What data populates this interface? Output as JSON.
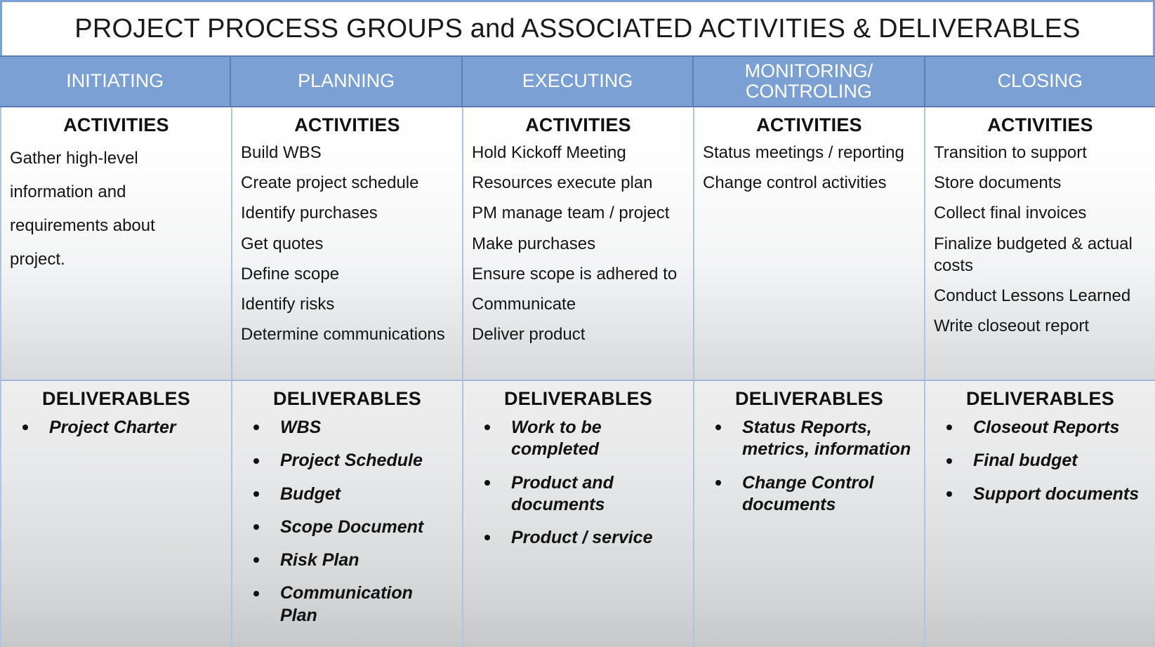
{
  "title": "PROJECT PROCESS GROUPS and ASSOCIATED ACTIVITIES & DELIVERABLES",
  "theme": {
    "header_blue": "#7BA0D4",
    "header_blue_border": "#5B7FB3",
    "divider_blue": "#AEC4E3",
    "text_dark": "#111111",
    "header_text": "#FFFFFF"
  },
  "labels": {
    "activities": "ACTIVITIES",
    "deliverables": "DELIVERABLES"
  },
  "columns": [
    {
      "phase": "INITIATING",
      "activities_heading": "ACTIVITIES",
      "activities": [
        "Gather high-level",
        "information and",
        "requirements about",
        "project."
      ],
      "activities_style": "paragraph",
      "deliverables_heading": "DELIVERABLES",
      "deliverables": [
        "Project Charter"
      ]
    },
    {
      "phase": "PLANNING",
      "activities_heading": "ACTIVITIES",
      "activities": [
        "Build WBS",
        "Create project schedule",
        "Identify purchases",
        "Get quotes",
        "Define scope",
        "Identify risks",
        "Determine communications"
      ],
      "activities_style": "list",
      "deliverables_heading": "DELIVERABLES",
      "deliverables": [
        "WBS",
        "Project Schedule",
        "Budget",
        "Scope Document",
        "Risk Plan",
        "Communication Plan"
      ]
    },
    {
      "phase": "EXECUTING",
      "activities_heading": "ACTIVITIES",
      "activities": [
        "Hold Kickoff Meeting",
        "Resources execute plan",
        "PM manage team / project",
        "Make purchases",
        "Ensure scope is adhered to",
        "Communicate",
        "Deliver product"
      ],
      "activities_style": "list",
      "deliverables_heading": "DELIVERABLES",
      "deliverables": [
        "Work to be completed",
        "Product and documents",
        "Product / service"
      ]
    },
    {
      "phase": "MONITORING/ CONTROLING",
      "phase_lines": [
        "MONITORING/",
        "CONTROLING"
      ],
      "activities_heading": "ACTIVITIES",
      "activities": [
        "Status meetings / reporting",
        "Change control activities"
      ],
      "activities_style": "list",
      "deliverables_heading": "DELIVERABLES",
      "deliverables": [
        "Status Reports, metrics, information",
        "Change Control documents"
      ]
    },
    {
      "phase": "CLOSING",
      "activities_heading": "ACTIVITIES",
      "activities": [
        "Transition to support",
        "Store documents",
        "Collect final invoices",
        "Finalize budgeted & actual costs",
        "Conduct Lessons Learned",
        "Write closeout report"
      ],
      "activities_style": "list",
      "deliverables_heading": "DELIVERABLES",
      "deliverables": [
        "Closeout Reports",
        "Final budget",
        "Support documents"
      ]
    }
  ]
}
